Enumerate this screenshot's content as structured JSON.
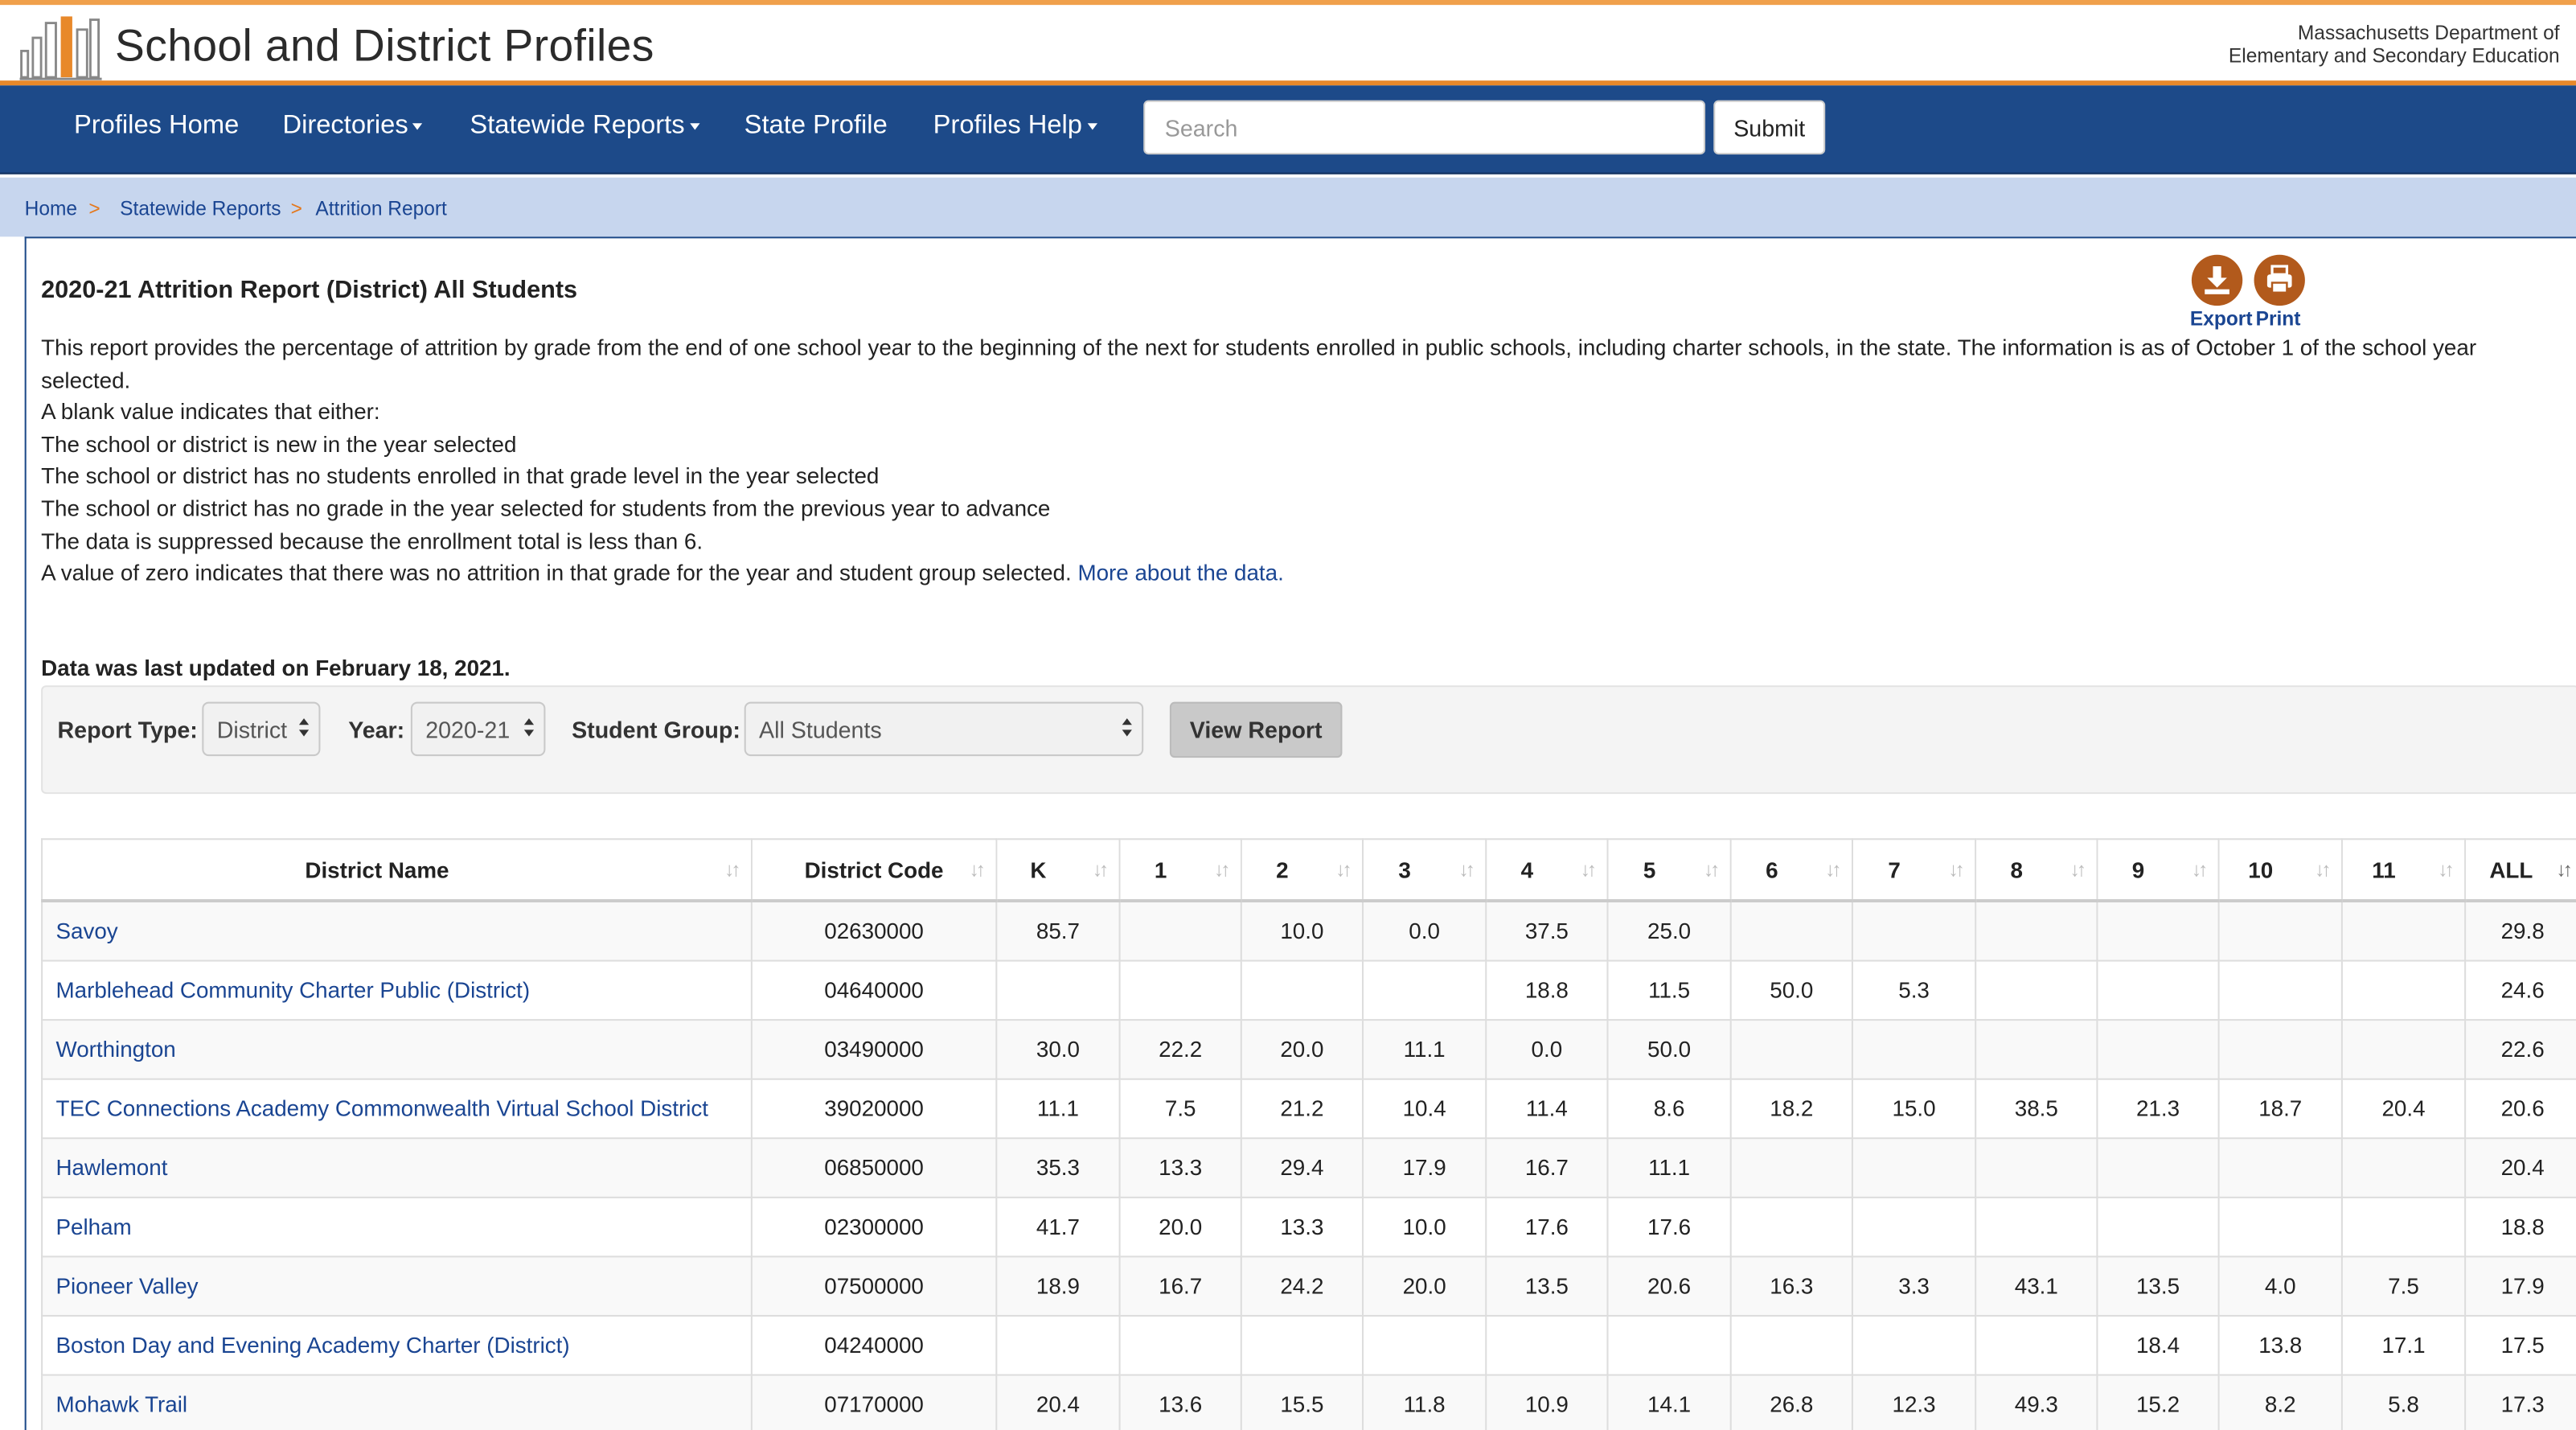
{
  "header": {
    "site_title": "School and District Profiles",
    "agency_line1": "Massachusetts Department of",
    "agency_line2": "Elementary and Secondary Education"
  },
  "nav": {
    "items": [
      {
        "label": "Profiles Home",
        "dropdown": false
      },
      {
        "label": "Directories",
        "dropdown": true
      },
      {
        "label": "Statewide Reports",
        "dropdown": true
      },
      {
        "label": "State Profile",
        "dropdown": false
      },
      {
        "label": "Profiles Help",
        "dropdown": true
      }
    ],
    "search_placeholder": "Search",
    "submit_label": "Submit"
  },
  "breadcrumb": {
    "items": [
      "Home",
      "Statewide Reports",
      "Attrition Report"
    ],
    "separator": ">"
  },
  "report": {
    "title": "2020-21 Attrition Report (District) All Students",
    "export_label": "Export",
    "print_label": "Print",
    "description": [
      "This report provides the percentage of attrition by grade from the end of one school year to the beginning of the next for students enrolled in public schools, including charter schools, in the state. The information is as of October 1 of the school year selected.",
      "A blank value indicates that either:",
      "The school or district is new in the year selected",
      "The school or district has no students enrolled in that grade level in the year selected",
      "The school or district has no grade in the year selected for students from the previous year to advance",
      "The data is suppressed because the enrollment total is less than 6."
    ],
    "zero_note": "A value of zero indicates that there was no attrition in that grade for the year and student group selected.",
    "more_link": "More about the data.",
    "updated": "Data was last updated on February 18, 2021."
  },
  "filters": {
    "report_type_label": "Report Type:",
    "report_type_value": "District",
    "year_label": "Year:",
    "year_value": "2020-21",
    "student_group_label": "Student Group:",
    "student_group_value": "All Students",
    "view_button": "View Report"
  },
  "table": {
    "headers": [
      "District Name",
      "District Code",
      "K",
      "1",
      "2",
      "3",
      "4",
      "5",
      "6",
      "7",
      "8",
      "9",
      "10",
      "11",
      "ALL"
    ],
    "rows": [
      [
        "Savoy",
        "02630000",
        "85.7",
        "",
        "10.0",
        "0.0",
        "37.5",
        "25.0",
        "",
        "",
        "",
        "",
        "",
        "",
        "29.8"
      ],
      [
        "Marblehead Community Charter Public (District)",
        "04640000",
        "",
        "",
        "",
        "",
        "18.8",
        "11.5",
        "50.0",
        "5.3",
        "",
        "",
        "",
        "",
        "24.6"
      ],
      [
        "Worthington",
        "03490000",
        "30.0",
        "22.2",
        "20.0",
        "11.1",
        "0.0",
        "50.0",
        "",
        "",
        "",
        "",
        "",
        "",
        "22.6"
      ],
      [
        "TEC Connections Academy Commonwealth Virtual School District",
        "39020000",
        "11.1",
        "7.5",
        "21.2",
        "10.4",
        "11.4",
        "8.6",
        "18.2",
        "15.0",
        "38.5",
        "21.3",
        "18.7",
        "20.4",
        "20.6"
      ],
      [
        "Hawlemont",
        "06850000",
        "35.3",
        "13.3",
        "29.4",
        "17.9",
        "16.7",
        "11.1",
        "",
        "",
        "",
        "",
        "",
        "",
        "20.4"
      ],
      [
        "Pelham",
        "02300000",
        "41.7",
        "20.0",
        "13.3",
        "10.0",
        "17.6",
        "17.6",
        "",
        "",
        "",
        "",
        "",
        "",
        "18.8"
      ],
      [
        "Pioneer Valley",
        "07500000",
        "18.9",
        "16.7",
        "24.2",
        "20.0",
        "13.5",
        "20.6",
        "16.3",
        "3.3",
        "43.1",
        "13.5",
        "4.0",
        "7.5",
        "17.9"
      ],
      [
        "Boston Day and Evening Academy Charter (District)",
        "04240000",
        "",
        "",
        "",
        "",
        "",
        "",
        "",
        "",
        "",
        "18.4",
        "13.8",
        "17.1",
        "17.5"
      ],
      [
        "Mohawk Trail",
        "07170000",
        "20.4",
        "13.6",
        "15.5",
        "11.8",
        "10.9",
        "14.1",
        "26.8",
        "12.3",
        "49.3",
        "15.2",
        "8.2",
        "5.8",
        "17.3"
      ]
    ]
  }
}
